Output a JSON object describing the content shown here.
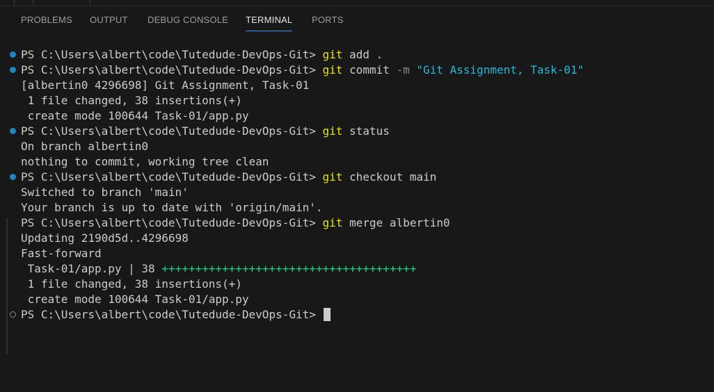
{
  "panel": {
    "tabs": [
      {
        "label": "PROBLEMS",
        "active": false
      },
      {
        "label": "OUTPUT",
        "active": false
      },
      {
        "label": "DEBUG CONSOLE",
        "active": false
      },
      {
        "label": "TERMINAL",
        "active": true
      },
      {
        "label": "PORTS",
        "active": false
      }
    ]
  },
  "terminal": {
    "prompt": "PS C:\\Users\\albert\\code\\Tutedude-DevOps-Git> ",
    "commands": [
      {
        "program": "git",
        "args": " add ."
      },
      {
        "program": "git",
        "args_before_flag": " commit ",
        "flag": "-m",
        "string_arg": " \"Git Assignment, Task-01\""
      },
      {
        "program": "git",
        "args": " status"
      },
      {
        "program": "git",
        "args": " checkout main"
      },
      {
        "program": "git",
        "args": " merge albertin0"
      }
    ],
    "outputs": {
      "commit": [
        "[albertin0 4296698] Git Assignment, Task-01",
        " 1 file changed, 38 insertions(+)",
        " create mode 100644 Task-01/app.py"
      ],
      "status": [
        "On branch albertin0",
        "nothing to commit, working tree clean"
      ],
      "checkout": [
        "Switched to branch 'main'",
        "Your branch is up to date with 'origin/main'."
      ],
      "merge_head": [
        "Updating 2190d5d..4296698",
        "Fast-forward"
      ],
      "merge_stat_prefix": " Task-01/app.py | 38 ",
      "merge_stat_plus": "++++++++++++++++++++++++++++++++++++++",
      "merge_tail": [
        " 1 file changed, 38 insertions(+)",
        " create mode 100644 Task-01/app.py"
      ]
    },
    "colors": {
      "background": "#181818",
      "command": "#e5e510",
      "string": "#29b8db",
      "insertions": "#23d18b",
      "success_decoration": "#1f87c4",
      "active_tab_border": "#3794ff"
    }
  }
}
